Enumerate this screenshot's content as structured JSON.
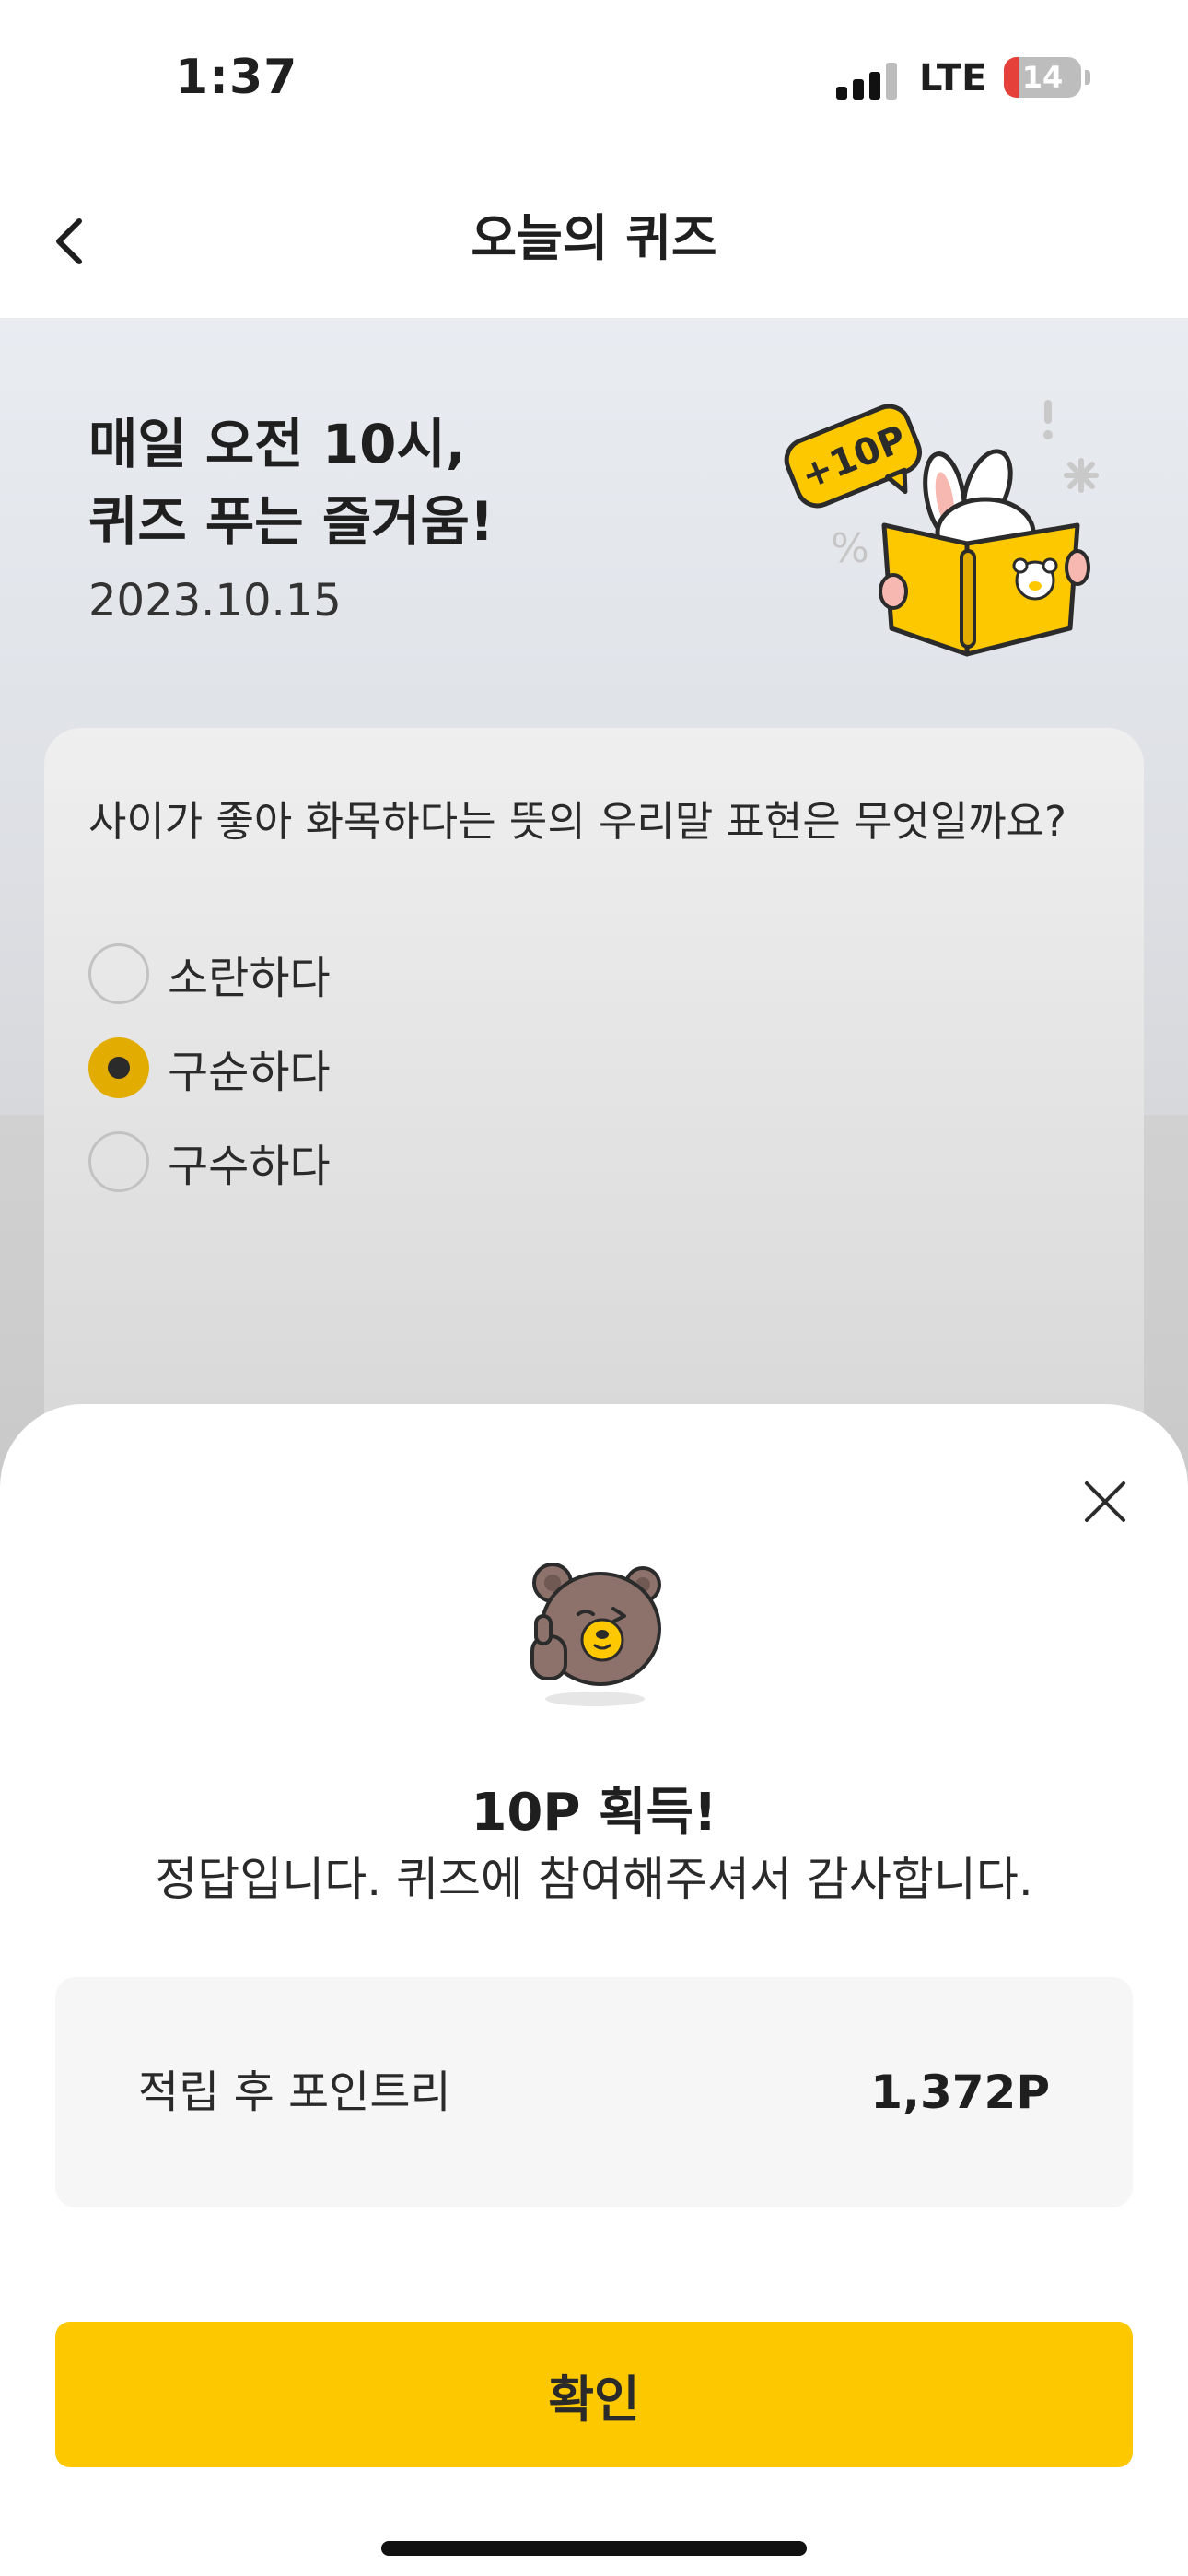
{
  "status_bar": {
    "time": "1:37",
    "network": "LTE",
    "battery": "14"
  },
  "nav": {
    "title": "오늘의 퀴즈",
    "back_icon": "chevron-left-icon"
  },
  "hero": {
    "title": "매일 오전 10시,\n퀴즈 푸는 즐거움!",
    "date": "2023.10.15",
    "badge": "+10P"
  },
  "quiz": {
    "question": "사이가 좋아 화목하다는 뜻의 우리말 표현은 무엇일까요?",
    "options": [
      {
        "label": "소란하다",
        "selected": false
      },
      {
        "label": "구순하다",
        "selected": true
      },
      {
        "label": "구수하다",
        "selected": false
      }
    ]
  },
  "sheet": {
    "title": "10P 획득!",
    "message": "정답입니다. 퀴즈에 참여해주셔서 감사합니다.",
    "points_label": "적립 후 포인트리",
    "points_value": "1,372P",
    "confirm_label": "확인",
    "close_icon": "close-icon"
  },
  "colors": {
    "accent": "#FDC800",
    "radio_selected": "#E2AC00",
    "battery_low": "#E5403A"
  }
}
